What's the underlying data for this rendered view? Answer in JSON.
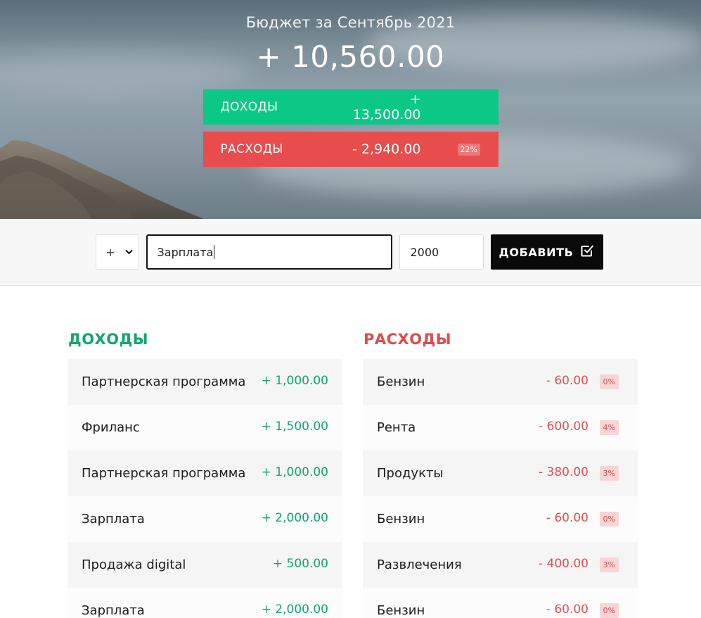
{
  "header": {
    "title": "Бюджет за Сентябрь 2021",
    "total": "+ 10,560.00",
    "income": {
      "label": "ДОХОДЫ",
      "amount": "+ 13,500.00"
    },
    "expenses": {
      "label": "РАСХОДЫ",
      "amount": "- 2,940.00",
      "percentage": "22%"
    }
  },
  "form": {
    "type": {
      "value": "+",
      "options": [
        "+"
      ]
    },
    "description": {
      "value": "Зарплата"
    },
    "amount": {
      "value": "2000"
    },
    "submit_label": "ДОБАВИТЬ",
    "submit_icon": "check-square-icon"
  },
  "income": {
    "title": "ДОХОДЫ",
    "items": [
      {
        "description": "Партнерская программа",
        "amount": "+ 1,000.00"
      },
      {
        "description": "Фриланс",
        "amount": "+ 1,500.00"
      },
      {
        "description": "Партнерская программа",
        "amount": "+ 1,000.00"
      },
      {
        "description": "Зарплата",
        "amount": "+ 2,000.00"
      },
      {
        "description": "Продажа digital",
        "amount": "+ 500.00"
      },
      {
        "description": "Зарплата",
        "amount": "+ 2,000.00"
      }
    ]
  },
  "expenses": {
    "title": "РАСХОДЫ",
    "items": [
      {
        "description": "Бензин",
        "amount": "- 60.00",
        "percentage": "0%"
      },
      {
        "description": "Рента",
        "amount": "- 600.00",
        "percentage": "4%"
      },
      {
        "description": "Продукты",
        "amount": "- 380.00",
        "percentage": "3%"
      },
      {
        "description": "Бензин",
        "amount": "- 60.00",
        "percentage": "0%"
      },
      {
        "description": "Развлечения",
        "amount": "- 400.00",
        "percentage": "3%"
      },
      {
        "description": "Бензин",
        "amount": "- 60.00",
        "percentage": "0%"
      }
    ]
  },
  "colors": {
    "income": "#0bc985",
    "expenses": "#e84c4c",
    "income_text": "#12a66f",
    "button": "#0a0a0a"
  }
}
